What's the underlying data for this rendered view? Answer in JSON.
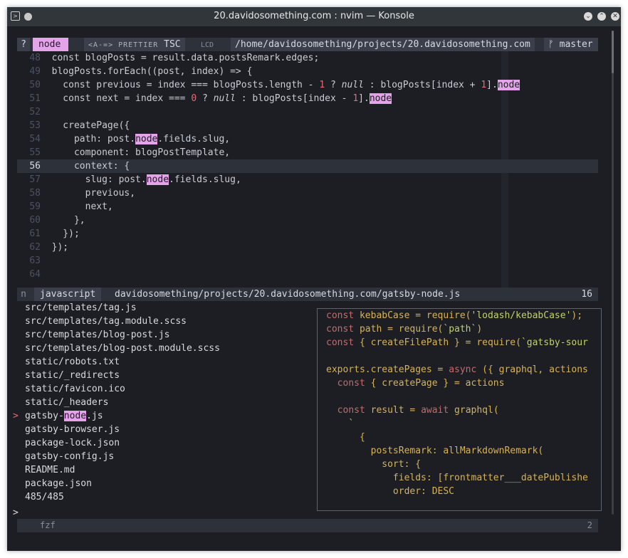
{
  "window": {
    "title": "20.davidosomething.com : nvim — Konsole"
  },
  "tabline": {
    "cmd": "?",
    "selected_tab": "node",
    "tsc_prefix": "<A-=> PRETTIER",
    "tsc_label": "TSC",
    "lcd": "LCD",
    "path": "/home/davidosomething/projects/20.davidosomething.com",
    "branch_icon": "ᚠ",
    "branch": "master"
  },
  "code": {
    "lines": [
      {
        "n": "48",
        "t": "const blogPosts = result.data.postsRemark.edges;"
      },
      {
        "n": "49",
        "t": "blogPosts.forEach((post, index) => {"
      },
      {
        "n": "50",
        "t": "  const previous = index === blogPosts.length - 1 ? null : blogPosts[index + 1].node"
      },
      {
        "n": "51",
        "t": "  const next = index === 0 ? null : blogPosts[index - 1].node"
      },
      {
        "n": "52",
        "t": ""
      },
      {
        "n": "53",
        "t": "  createPage({"
      },
      {
        "n": "54",
        "t": "    path: post.node.fields.slug,"
      },
      {
        "n": "55",
        "t": "    component: blogPostTemplate,"
      },
      {
        "n": "56",
        "t": "    context: {"
      },
      {
        "n": "57",
        "t": "      slug: post.node.fields.slug,"
      },
      {
        "n": "58",
        "t": "      previous,"
      },
      {
        "n": "59",
        "t": "      next,"
      },
      {
        "n": "60",
        "t": "    },"
      },
      {
        "n": "61",
        "t": "  });"
      },
      {
        "n": "62",
        "t": "});"
      },
      {
        "n": "63",
        "t": ""
      },
      {
        "n": "64",
        "t": ""
      }
    ]
  },
  "statusline": {
    "mode": "n",
    "filetype": "javascript",
    "path": "davidosomething/projects/20.davidosomething.com/gatsby-node.js",
    "col": "16"
  },
  "fzf": {
    "files": [
      "src/templates/tag.js",
      "src/templates/tag.module.scss",
      "src/templates/blog-post.js",
      "src/templates/blog-post.module.scss",
      "static/robots.txt",
      "static/_redirects",
      "static/favicon.ico",
      "static/_headers",
      "gatsby-node.js",
      "gatsby-browser.js",
      "package-lock.json",
      "gatsby-config.js",
      "README.md",
      "package.json"
    ],
    "selected_marker": ">",
    "count": "485/485",
    "prompt": ">",
    "footer_label": "fzf",
    "footer_num": "2",
    "preview": [
      "const kebabCase = require('lodash/kebabCase');",
      "const path = require(`path`)",
      "const { createFilePath } = require(`gatsby-sour",
      "",
      "exports.createPages = async ({ graphql, actions",
      "  const { createPage } = actions",
      "",
      "  const result = await graphql(",
      "    `",
      "      {",
      "        postsRemark: allMarkdownRemark(",
      "          sort: {",
      "            fields: [frontmatter___datePublishe",
      "            order: DESC"
    ]
  },
  "colors": {
    "highlight": "#e5a3ea",
    "background": "#1c1e23",
    "titlebar": "#31363b"
  }
}
